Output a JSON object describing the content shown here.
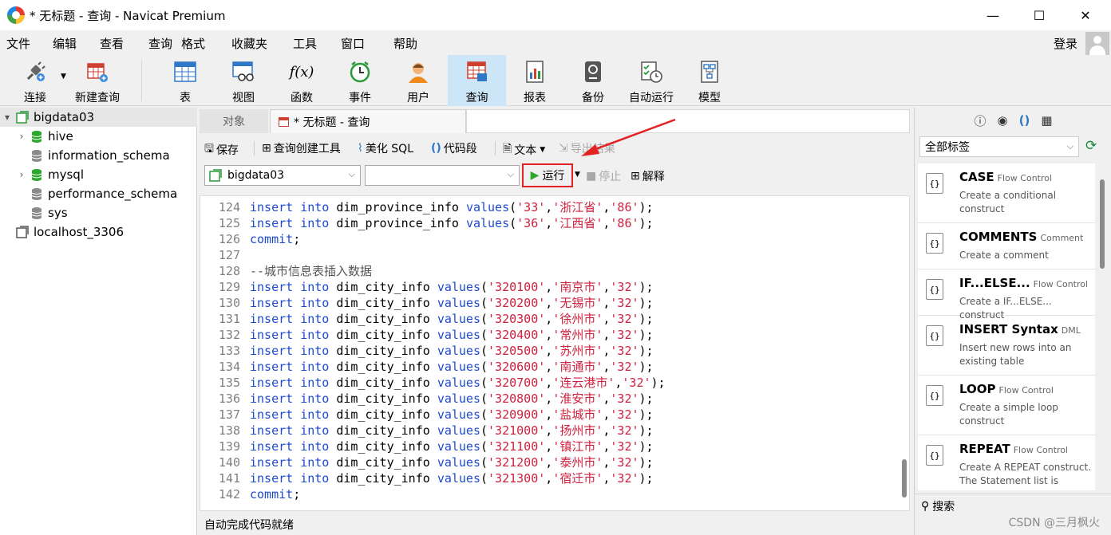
{
  "window": {
    "title": "* 无标题 - 查询 - Navicat Premium",
    "controls": {
      "minimize": "—",
      "maximize": "☐",
      "close": "✕"
    }
  },
  "menu": {
    "items": [
      "文件",
      "编辑",
      "查看",
      "查询",
      "格式",
      "收藏夹",
      "工具",
      "窗口",
      "帮助"
    ],
    "login": "登录"
  },
  "toolbar": {
    "items": [
      {
        "label": "连接",
        "icon": "plug-icon"
      },
      {
        "label": "新建查询",
        "icon": "new-query-icon"
      },
      {
        "label": "表",
        "icon": "table-icon"
      },
      {
        "label": "视图",
        "icon": "view-icon"
      },
      {
        "label": "函数",
        "icon": "function-icon",
        "glyph": "f(x)"
      },
      {
        "label": "事件",
        "icon": "clock-icon"
      },
      {
        "label": "用户",
        "icon": "user-icon"
      },
      {
        "label": "查询",
        "icon": "query-icon",
        "active": true
      },
      {
        "label": "报表",
        "icon": "report-icon"
      },
      {
        "label": "备份",
        "icon": "backup-icon"
      },
      {
        "label": "自动运行",
        "icon": "automation-icon"
      },
      {
        "label": "模型",
        "icon": "model-icon"
      }
    ]
  },
  "sidebar": {
    "connection": "bigdata03",
    "databases": [
      {
        "name": "hive",
        "open": true,
        "expandable": true
      },
      {
        "name": "information_schema",
        "open": false,
        "expandable": false
      },
      {
        "name": "mysql",
        "open": true,
        "expandable": true
      },
      {
        "name": "performance_schema",
        "open": false,
        "expandable": false
      },
      {
        "name": "sys",
        "open": false,
        "expandable": false
      }
    ],
    "other_connection": "localhost_3306"
  },
  "tabs": {
    "objects": "对象",
    "query": "* 无标题 - 查询"
  },
  "query_toolbar": {
    "save": "保存",
    "builder": "查询创建工具",
    "beautify": "美化 SQL",
    "snippet": "代码段",
    "text": "文本",
    "export": "导出结果"
  },
  "selectors": {
    "connection": "bigdata03",
    "database": "",
    "run": "运行",
    "stop": "停止",
    "explain": "解释"
  },
  "editor": {
    "lines": [
      {
        "n": "124",
        "type": "province",
        "code": "'33'",
        "name": "'浙江省'",
        "prov": "'86'"
      },
      {
        "n": "125",
        "type": "province",
        "code": "'36'",
        "name": "'江西省'",
        "prov": "'86'"
      },
      {
        "n": "126",
        "type": "commit"
      },
      {
        "n": "127",
        "type": "blank"
      },
      {
        "n": "128",
        "type": "comment",
        "text": "--城市信息表插入数据"
      },
      {
        "n": "129",
        "type": "city",
        "code": "'320100'",
        "name": "'南京市'",
        "prov": "'32'"
      },
      {
        "n": "130",
        "type": "city",
        "code": "'320200'",
        "name": "'无锡市'",
        "prov": "'32'"
      },
      {
        "n": "131",
        "type": "city",
        "code": "'320300'",
        "name": "'徐州市'",
        "prov": "'32'"
      },
      {
        "n": "132",
        "type": "city",
        "code": "'320400'",
        "name": "'常州市'",
        "prov": "'32'"
      },
      {
        "n": "133",
        "type": "city",
        "code": "'320500'",
        "name": "'苏州市'",
        "prov": "'32'"
      },
      {
        "n": "134",
        "type": "city",
        "code": "'320600'",
        "name": "'南通市'",
        "prov": "'32'"
      },
      {
        "n": "135",
        "type": "city",
        "code": "'320700'",
        "name": "'连云港市'",
        "prov": "'32'"
      },
      {
        "n": "136",
        "type": "city",
        "code": "'320800'",
        "name": "'淮安市'",
        "prov": "'32'"
      },
      {
        "n": "137",
        "type": "city",
        "code": "'320900'",
        "name": "'盐城市'",
        "prov": "'32'"
      },
      {
        "n": "138",
        "type": "city",
        "code": "'321000'",
        "name": "'扬州市'",
        "prov": "'32'"
      },
      {
        "n": "139",
        "type": "city",
        "code": "'321100'",
        "name": "'镇江市'",
        "prov": "'32'"
      },
      {
        "n": "140",
        "type": "city",
        "code": "'321200'",
        "name": "'泰州市'",
        "prov": "'32'"
      },
      {
        "n": "141",
        "type": "city",
        "code": "'321300'",
        "name": "'宿迁市'",
        "prov": "'32'"
      },
      {
        "n": "142",
        "type": "commit"
      }
    ],
    "tokens": {
      "insert": "insert",
      "into": "into",
      "values": "values",
      "commit": "commit",
      "province_table": "dim_province_info",
      "city_table": "dim_city_info"
    }
  },
  "status": "自动完成代码就绪",
  "snippet_panel": {
    "filter": "全部标签",
    "search": "搜索",
    "items": [
      {
        "name": "CASE",
        "category": "Flow Control",
        "desc": "Create a conditional construct"
      },
      {
        "name": "COMMENTS",
        "category": "Comment",
        "desc": "Create a comment"
      },
      {
        "name": "IF...ELSE...",
        "category": "Flow Control",
        "desc": "Create a IF...ELSE... construct"
      },
      {
        "name": "INSERT Syntax",
        "category": "DML",
        "desc": "Insert new rows into an existing table"
      },
      {
        "name": "LOOP",
        "category": "Flow Control",
        "desc": "Create a simple loop construct"
      },
      {
        "name": "REPEAT",
        "category": "Flow Control",
        "desc": "Create A REPEAT construct. The Statement list is"
      }
    ]
  },
  "watermark": "CSDN @三月枫火",
  "colors": {
    "keyword": "#1d4bd0",
    "string": "#d01f3c",
    "highlight": "#e32222",
    "db_green": "#2aa82a",
    "active_tab": "#cde6f7"
  }
}
